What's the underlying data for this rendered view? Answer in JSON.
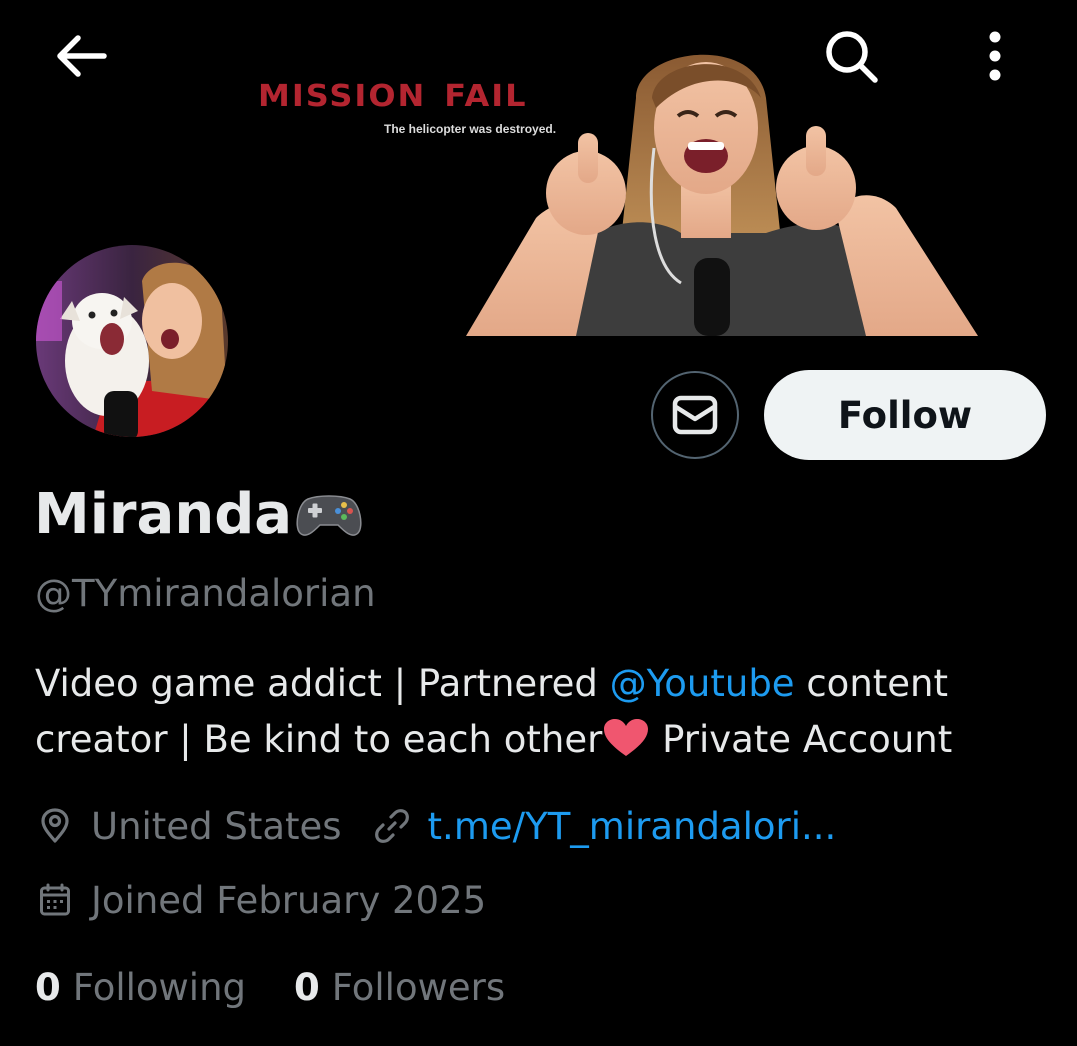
{
  "header": {
    "back_icon": "arrow-left-icon",
    "search_icon": "search-icon",
    "more_icon": "more-vertical-icon"
  },
  "banner": {
    "game_text": "mission fail",
    "game_subtext": "The helicopter was destroyed."
  },
  "actions": {
    "message_icon": "mail-icon",
    "follow_label": "Follow"
  },
  "profile": {
    "display_name": "Miranda",
    "name_emoji": "game-controller-emoji",
    "handle": "@TYmirandalorian",
    "bio": {
      "part1": "Video game addict | Partnered ",
      "mention": "@Youtube",
      "part2": " content creator | Be kind to each other",
      "heart_emoji": "heart-emoji",
      "part3": " Private Account"
    },
    "location": "United States",
    "website": "t.me/YT_mirandalori...",
    "joined": "Joined February 2025",
    "following_count": "0",
    "following_label": "Following",
    "followers_count": "0",
    "followers_label": "Followers"
  },
  "colors": {
    "background": "#000000",
    "primary_text": "#e7e9ea",
    "secondary_text": "#71767b",
    "link": "#1d9bf0",
    "follow_button_bg": "#eff3f4",
    "banner_red": "#b32530"
  }
}
